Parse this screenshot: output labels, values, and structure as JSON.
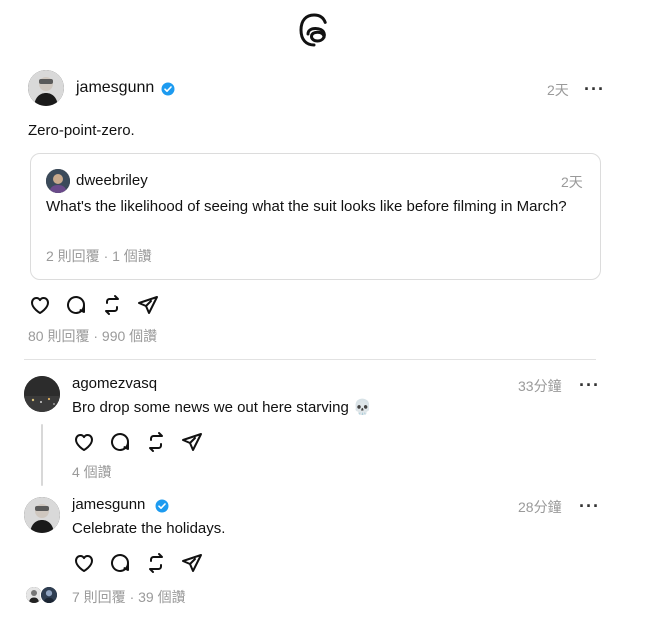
{
  "logo": {
    "icon": "threads-logo-icon"
  },
  "post": {
    "username": "jamesgunn",
    "verified": true,
    "time": "2天",
    "text": "Zero-point-zero.",
    "stats": "80 則回覆 · 990 個讚",
    "quote": {
      "username": "dweebriley",
      "time": "2天",
      "text": "What's the likelihood of seeing what the suit looks like before filming in March?",
      "stats": "2 則回覆 · 1 個讚"
    }
  },
  "replies": [
    {
      "username": "agomezvasq",
      "time": "33分鐘",
      "text": "Bro drop some news we out here starving 💀",
      "stats": "4 個讚"
    },
    {
      "username": "jamesgunn",
      "verified": true,
      "time": "28分鐘",
      "text": "Celebrate the holidays.",
      "stats": "7 則回覆 · 39 個讚"
    }
  ],
  "colors": {
    "verified": "#1d9bf0",
    "muted": "#9a9a9a",
    "text": "#111111"
  },
  "icons": [
    "heart-icon",
    "comment-icon",
    "repost-icon",
    "share-icon",
    "more-icon"
  ]
}
